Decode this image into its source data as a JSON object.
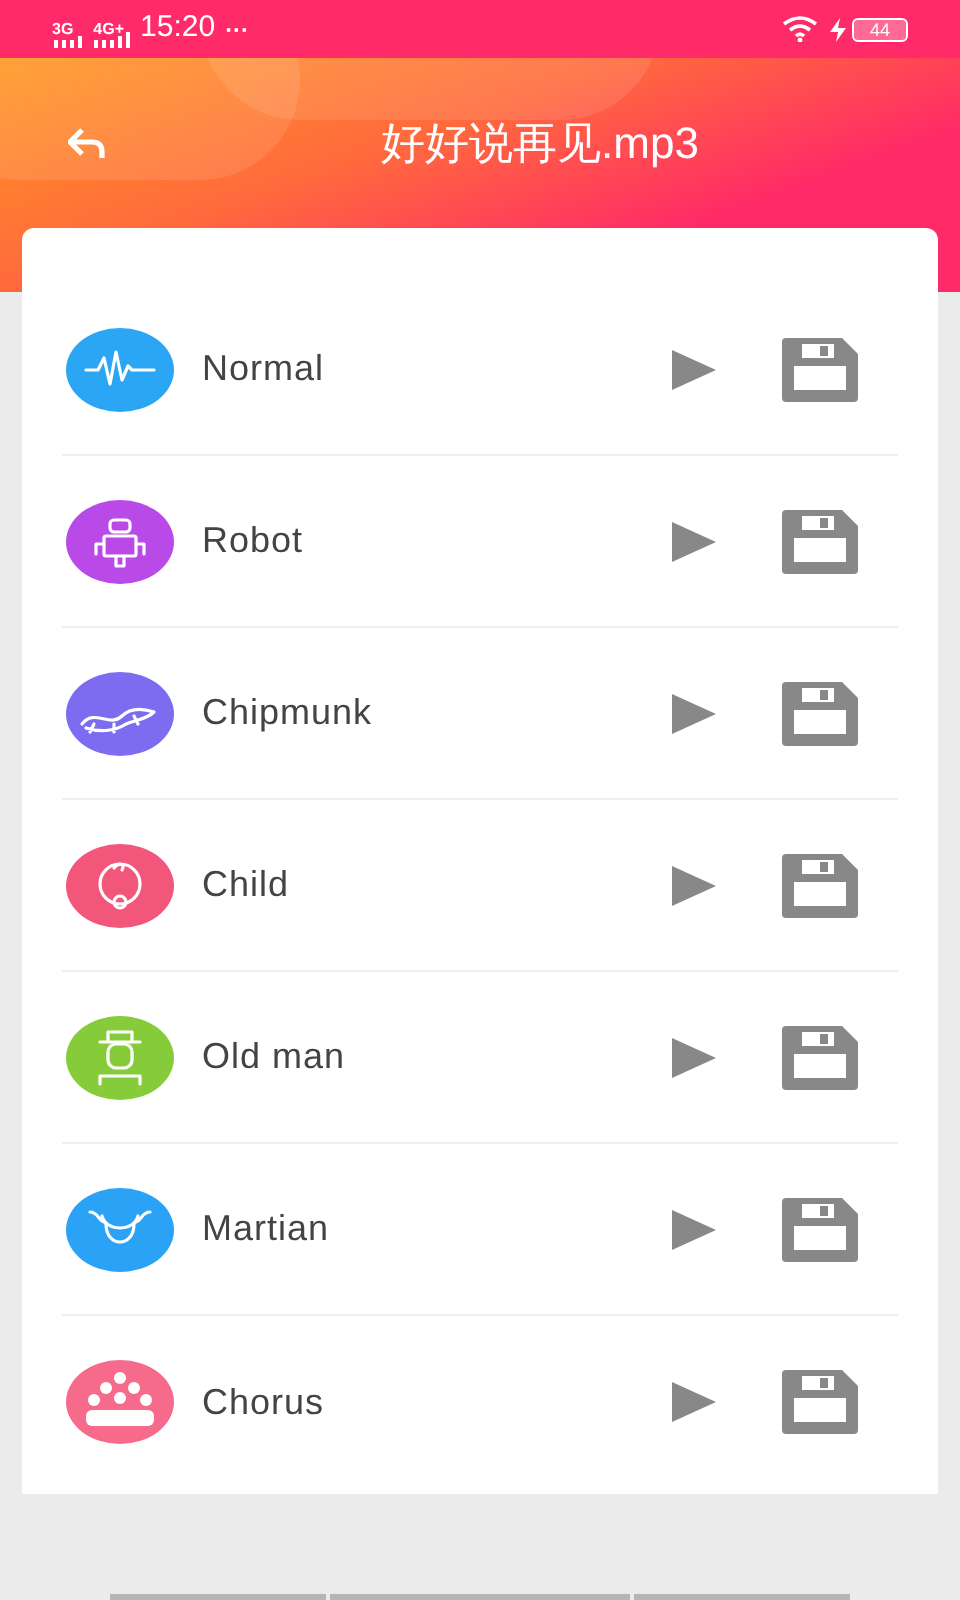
{
  "status_bar": {
    "network_1": "3G",
    "network_2": "4G+",
    "time": "15:20",
    "more": "···",
    "battery": "44"
  },
  "header": {
    "title": "好好说再见.mp3"
  },
  "effects": [
    {
      "name": "Normal",
      "kind": "wave",
      "color": "#2ba6f5"
    },
    {
      "name": "Robot",
      "kind": "robot",
      "color": "#b94ae8"
    },
    {
      "name": "Chipmunk",
      "kind": "chipmunk",
      "color": "#7d6cf0"
    },
    {
      "name": "Child",
      "kind": "child",
      "color": "#f2567a"
    },
    {
      "name": "Old man",
      "kind": "oldman",
      "color": "#86cc3a"
    },
    {
      "name": "Martian",
      "kind": "martian",
      "color": "#2aa2f5"
    },
    {
      "name": "Chorus",
      "kind": "chorus",
      "color": "#f66b8c"
    }
  ]
}
